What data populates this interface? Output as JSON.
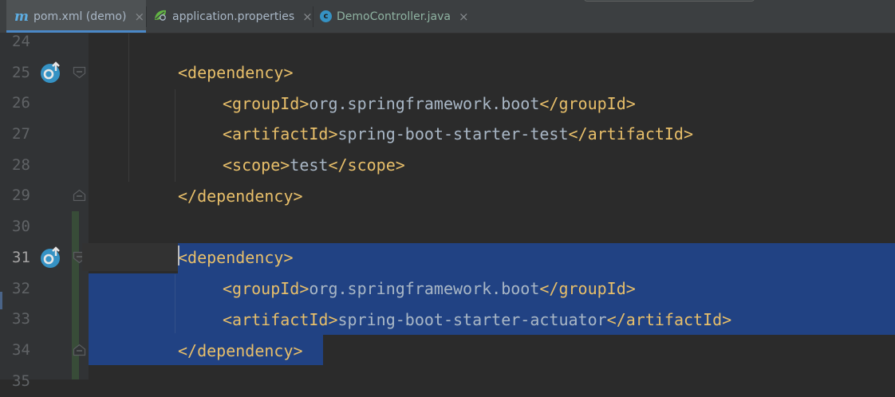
{
  "tabs": [
    {
      "label": "pom.xml (demo)",
      "icon": "maven-m-icon",
      "active": true
    },
    {
      "label": "application.properties",
      "icon": "spring-leaf-icon",
      "active": false
    },
    {
      "label": "DemoController.java",
      "icon": "java-class-icon",
      "active": false
    }
  ],
  "close_glyph": "×",
  "m_glyph": "m",
  "c_glyph": "c",
  "line_numbers": [
    "24",
    "25",
    "26",
    "27",
    "28",
    "29",
    "30",
    "31",
    "32",
    "33",
    "34",
    "35"
  ],
  "code": {
    "l25": {
      "open": "<dependency>"
    },
    "l26": {
      "open": "<groupId>",
      "text": "org.springframework.boot",
      "close": "</groupId>"
    },
    "l27": {
      "open": "<artifactId>",
      "text": "spring-boot-starter-test",
      "close": "</artifactId>"
    },
    "l28": {
      "open": "<scope>",
      "text": "test",
      "close": "</scope>"
    },
    "l29": {
      "close": "</dependency>"
    },
    "l31": {
      "open": "<dependency>"
    },
    "l32": {
      "open": "<groupId>",
      "text": "org.springframework.boot",
      "close": "</groupId>"
    },
    "l33": {
      "open": "<artifactId>",
      "text": "spring-boot-starter-actuator",
      "close": "</artifactId>"
    },
    "l34": {
      "close": "</dependency>"
    }
  },
  "colors": {
    "background": "#2b2b2b",
    "gutter": "#313335",
    "tag": "#e8bf6a",
    "text": "#a9b7c6",
    "selection": "#214283",
    "line_number": "#606366",
    "tab_underline": "#4a88c7"
  }
}
